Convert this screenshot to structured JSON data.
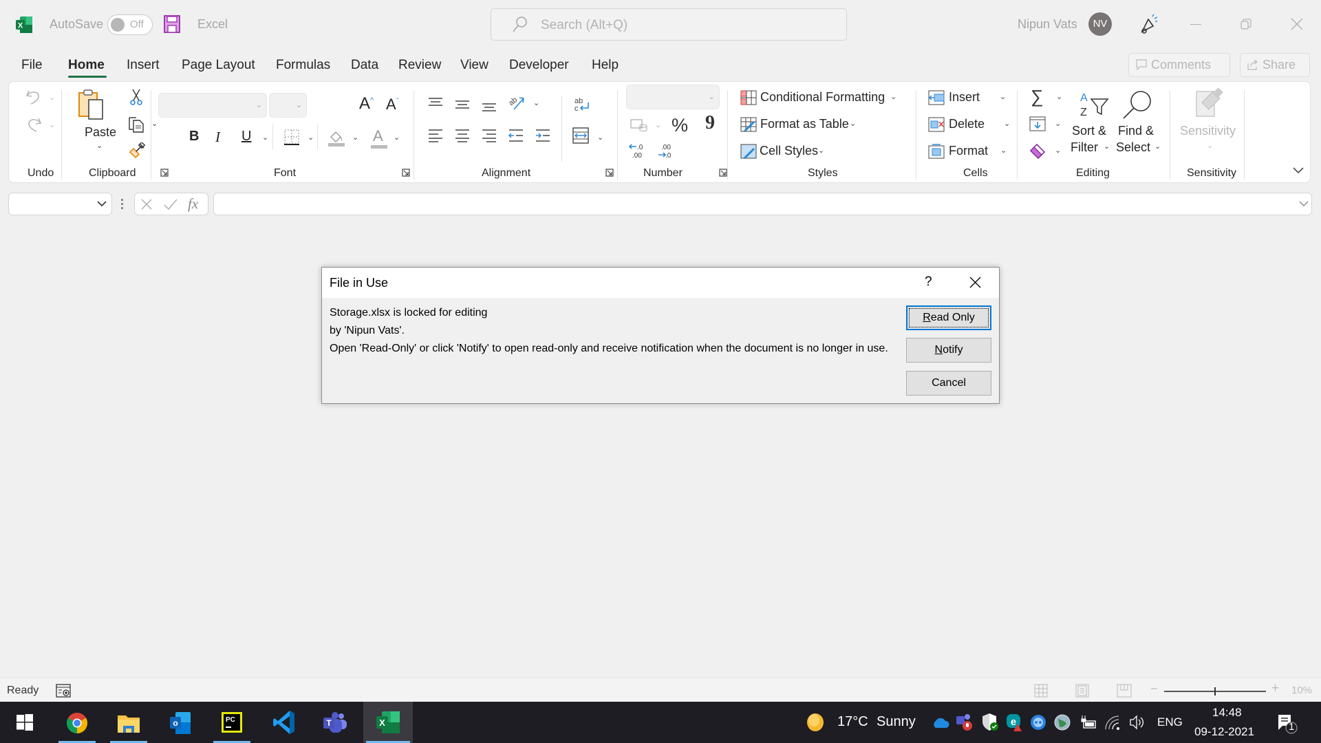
{
  "titlebar": {
    "app_icon": "excel-logo-icon",
    "autosave_label": "AutoSave",
    "autosave_state": "Off",
    "save_icon": "save-icon",
    "app_name": "Excel",
    "search_placeholder": "Search (Alt+Q)",
    "user_name": "Nipun Vats",
    "user_initials": "NV",
    "window_controls": [
      "minimize",
      "restore",
      "close"
    ]
  },
  "tabs": [
    {
      "label": "File",
      "active": false
    },
    {
      "label": "Home",
      "active": true
    },
    {
      "label": "Insert",
      "active": false
    },
    {
      "label": "Page Layout",
      "active": false
    },
    {
      "label": "Formulas",
      "active": false
    },
    {
      "label": "Data",
      "active": false
    },
    {
      "label": "Review",
      "active": false
    },
    {
      "label": "View",
      "active": false
    },
    {
      "label": "Developer",
      "active": false
    },
    {
      "label": "Help",
      "active": false
    }
  ],
  "header_buttons": {
    "comments": "Comments",
    "share": "Share"
  },
  "ribbon": {
    "groups": {
      "undo": "Undo",
      "clipboard": "Clipboard",
      "font": "Font",
      "alignment": "Alignment",
      "number": "Number",
      "styles": "Styles",
      "cells": "Cells",
      "editing": "Editing",
      "sensitivity": "Sensitivity"
    },
    "clipboard": {
      "paste": "Paste"
    },
    "font": {
      "bold": "B",
      "italic": "I",
      "underline": "U",
      "font_color": "A",
      "grow": "A",
      "shrink": "A",
      "font_name": "",
      "font_size": ""
    },
    "number": {
      "format": "",
      "percent": "%",
      "comma": "9",
      "inc_decimal_a": ".0",
      "inc_decimal_b": ".00",
      "dec_decimal_a": ".00",
      "dec_decimal_b": ".0"
    },
    "styles": {
      "conditional_formatting": "Conditional Formatting",
      "format_as_table": "Format as Table",
      "cell_styles": "Cell Styles"
    },
    "cells": {
      "insert": "Insert",
      "delete": "Delete",
      "format": "Format"
    },
    "editing": {
      "sort_line1": "Sort &",
      "sort_line2": "Filter",
      "find_line1": "Find &",
      "find_line2": "Select"
    },
    "sensitivity": {
      "label": "Sensitivity"
    }
  },
  "formula_bar": {
    "name_box": "",
    "formula": "",
    "fx": "fx"
  },
  "dialog": {
    "title": "File in Use",
    "help": "?",
    "message_line1": "Storage.xlsx is locked for editing",
    "message_line2": "by 'Nipun Vats'.",
    "message_line3": "Open 'Read-Only' or click 'Notify' to open read-only and receive notification when the document is no longer in use.",
    "buttons": {
      "read_only": {
        "accel": "R",
        "rest": "ead Only"
      },
      "notify": {
        "accel": "N",
        "rest": "otify"
      },
      "cancel": "Cancel"
    }
  },
  "statusbar": {
    "status": "Ready",
    "zoom_level": "10%",
    "zoom_slider_fraction": 0.5,
    "views": [
      "normal-view",
      "page-layout-view",
      "page-break-view"
    ]
  },
  "taskbar": {
    "apps": [
      {
        "name": "start",
        "running": false
      },
      {
        "name": "chrome",
        "running": true
      },
      {
        "name": "file-explorer",
        "running": true
      },
      {
        "name": "outlook",
        "running": false
      },
      {
        "name": "pycharm",
        "running": true
      },
      {
        "name": "vscode",
        "running": false
      },
      {
        "name": "teams",
        "running": false
      },
      {
        "name": "excel",
        "running": true,
        "active": true
      }
    ],
    "weather": {
      "temp": "17°C",
      "condition": "Sunny"
    },
    "language": "ENG",
    "time": "14:48",
    "date": "09-12-2021",
    "notification_count": "1"
  },
  "colors": {
    "excel_green": "#1e7145",
    "accent_blue": "#0078d7",
    "save_purple": "#b146c2",
    "taskbar_bg": "#1d1d23"
  }
}
